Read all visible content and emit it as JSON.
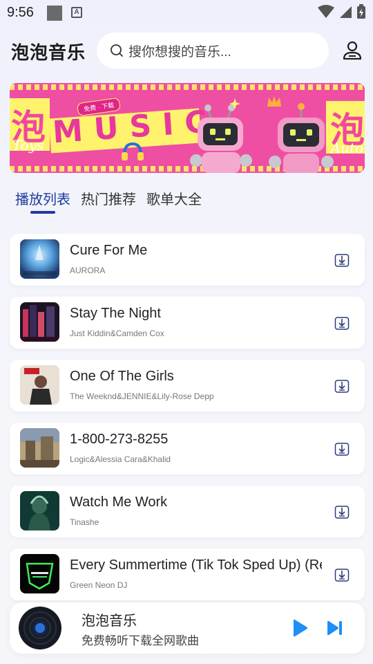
{
  "status_bar": {
    "time": "9:56"
  },
  "header": {
    "title": "泡泡音乐",
    "search_placeholder": "搜你想搜的音乐..."
  },
  "banner": {
    "pao": "泡",
    "music": "MUSIC",
    "toys": "Toys",
    "auto": "Auto",
    "badge": "免费 · 下载"
  },
  "tabs": [
    {
      "label": "播放列表",
      "active": true
    },
    {
      "label": "热门推荐",
      "active": false
    },
    {
      "label": "歌单大全",
      "active": false
    }
  ],
  "songs": [
    {
      "title": "Cure For Me",
      "artist": "AURORA"
    },
    {
      "title": "Stay The Night",
      "artist": "Just Kiddin&Camden Cox"
    },
    {
      "title": "One Of The Girls",
      "artist": "The Weeknd&JENNIE&Lily-Rose Depp"
    },
    {
      "title": "1-800-273-8255",
      "artist": "Logic&Alessia Cara&Khalid"
    },
    {
      "title": "Watch Me Work",
      "artist": "Tinashe"
    },
    {
      "title": "Every Summertime (Tik Tok Sped Up) (Remix)",
      "artist": "Green Neon DJ"
    }
  ],
  "player": {
    "title": "泡泡音乐",
    "subtitle": "免费畅听下载全网歌曲"
  },
  "colors": {
    "accent": "#1e3a9e",
    "play_blue": "#1f8ef5",
    "banner_pink": "#ee4fa2",
    "banner_yellow": "#fff36e"
  }
}
